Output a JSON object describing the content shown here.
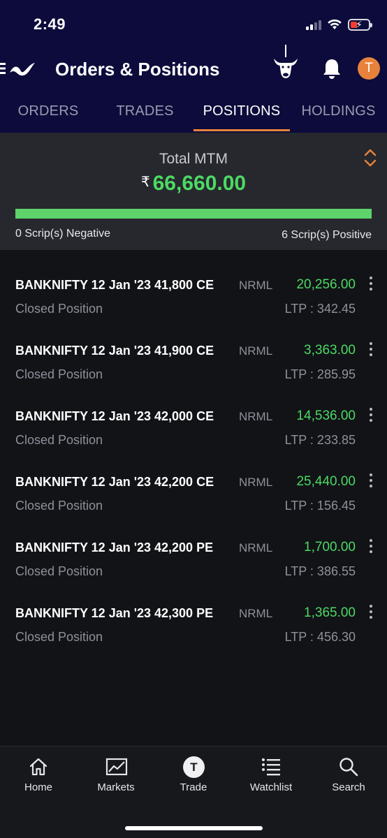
{
  "status_bar": {
    "time": "2:49",
    "battery_bolt": "⚡"
  },
  "header": {
    "title": "Orders & Positions",
    "avatar_initial": "T",
    "icons": [
      "menu-logo-icon",
      "bull-icon",
      "bell-icon"
    ]
  },
  "tabs": [
    {
      "label": "ORDERS"
    },
    {
      "label": "TRADES"
    },
    {
      "label": "POSITIONS"
    },
    {
      "label": "HOLDINGS"
    }
  ],
  "active_tab": "POSITIONS",
  "summary": {
    "label": "Total MTM",
    "currency": "₹",
    "value": "66,660.00",
    "negative_text": "0 Scrip(s) Negative",
    "positive_text": "6 Scrip(s) Positive",
    "positive_fraction": 1.0
  },
  "positions": [
    {
      "name": "BANKNIFTY 12 Jan '23 41,800 CE",
      "product": "NRML",
      "pnl": "20,256.00",
      "status": "Closed Position",
      "ltp": "LTP : 342.45"
    },
    {
      "name": "BANKNIFTY 12 Jan '23 41,900 CE",
      "product": "NRML",
      "pnl": "3,363.00",
      "status": "Closed Position",
      "ltp": "LTP : 285.95"
    },
    {
      "name": "BANKNIFTY 12 Jan '23 42,000 CE",
      "product": "NRML",
      "pnl": "14,536.00",
      "status": "Closed Position",
      "ltp": "LTP : 233.85"
    },
    {
      "name": "BANKNIFTY 12 Jan '23 42,200 CE",
      "product": "NRML",
      "pnl": "25,440.00",
      "status": "Closed Position",
      "ltp": "LTP : 156.45"
    },
    {
      "name": "BANKNIFTY 12 Jan '23 42,200 PE",
      "product": "NRML",
      "pnl": "1,700.00",
      "status": "Closed Position",
      "ltp": "LTP : 386.55"
    },
    {
      "name": "BANKNIFTY 12 Jan '23 42,300 PE",
      "product": "NRML",
      "pnl": "1,365.00",
      "status": "Closed Position",
      "ltp": "LTP : 456.30"
    }
  ],
  "bottom_nav": [
    {
      "label": "Home",
      "icon": "home-icon"
    },
    {
      "label": "Markets",
      "icon": "chart-icon"
    },
    {
      "label": "Trade",
      "icon": "trade-icon",
      "glyph": "T"
    },
    {
      "label": "Watchlist",
      "icon": "list-icon"
    },
    {
      "label": "Search",
      "icon": "search-icon"
    }
  ],
  "colors": {
    "header_bg": "#0c0b3b",
    "accent": "#e8823b",
    "positive": "#4cd964",
    "panel_bg": "#27282d",
    "body_bg": "#121317"
  }
}
